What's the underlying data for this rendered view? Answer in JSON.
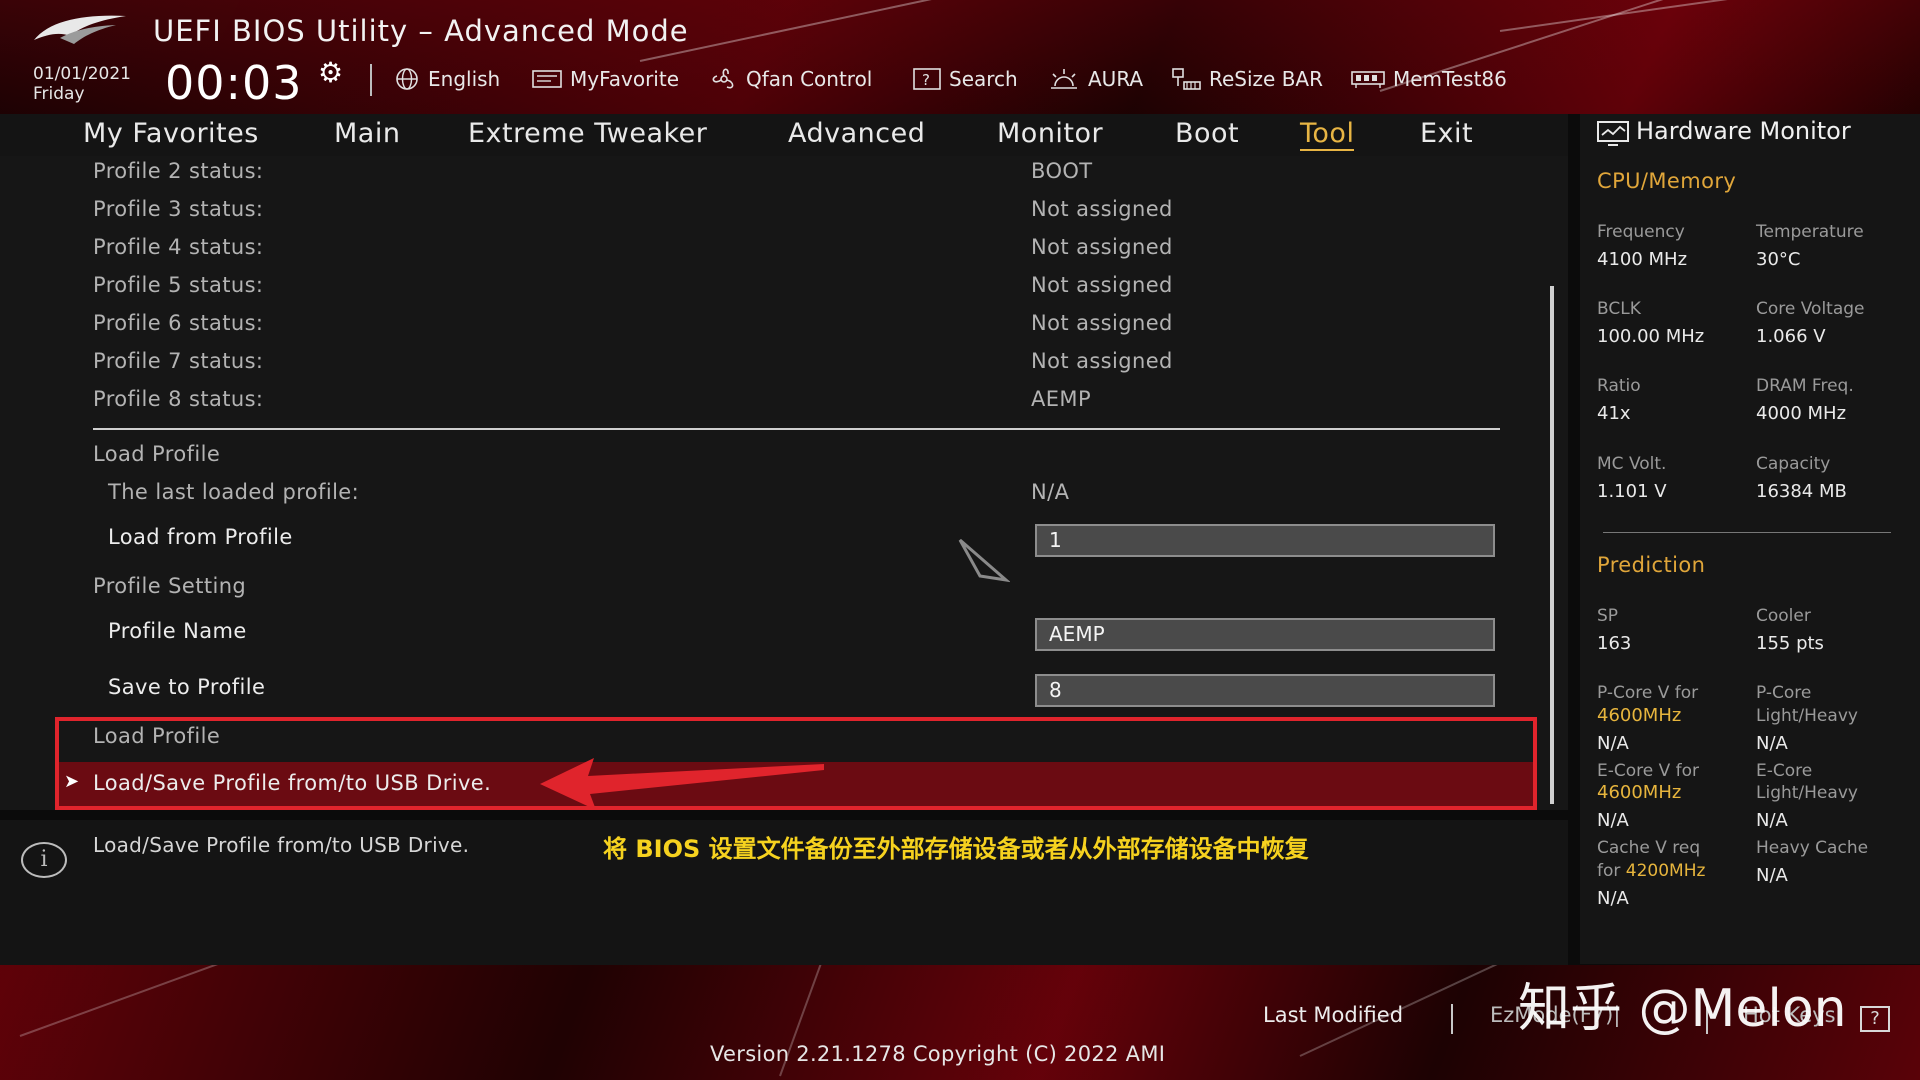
{
  "header": {
    "title": "UEFI BIOS Utility – Advanced Mode",
    "date": "01/01/2021",
    "day": "Friday",
    "time": "00:03",
    "tools": [
      {
        "label": "English",
        "icon": "globe-icon"
      },
      {
        "label": "MyFavorite",
        "icon": "favorite-icon"
      },
      {
        "label": "Qfan Control",
        "icon": "fan-icon"
      },
      {
        "label": "Search",
        "icon": "search-icon"
      },
      {
        "label": "AURA",
        "icon": "aura-icon"
      },
      {
        "label": "ReSize BAR",
        "icon": "resize-bar-icon"
      },
      {
        "label": "MemTest86",
        "icon": "memtest-icon"
      }
    ]
  },
  "nav": {
    "tabs": [
      "My Favorites",
      "Main",
      "Extreme Tweaker",
      "Advanced",
      "Monitor",
      "Boot",
      "Tool",
      "Exit"
    ],
    "active": "Tool"
  },
  "main": {
    "profiles": [
      {
        "label": "Profile 2 status:",
        "value": "BOOT"
      },
      {
        "label": "Profile 3 status:",
        "value": "Not assigned"
      },
      {
        "label": "Profile 4 status:",
        "value": "Not assigned"
      },
      {
        "label": "Profile 5 status:",
        "value": "Not assigned"
      },
      {
        "label": "Profile 6 status:",
        "value": "Not assigned"
      },
      {
        "label": "Profile 7 status:",
        "value": "Not assigned"
      },
      {
        "label": "Profile 8 status:",
        "value": "AEMP"
      }
    ],
    "load_profile_header": "Load Profile",
    "last_loaded_label": "The last loaded profile:",
    "last_loaded_value": "N/A",
    "load_from_label": "Load from Profile",
    "load_from_value": "1",
    "profile_setting_header": "Profile Setting",
    "profile_name_label": "Profile Name",
    "profile_name_value": "AEMP",
    "save_to_label": "Save to Profile",
    "save_to_value": "8",
    "load_profile_header_2": "Load Profile",
    "usb_item": "Load/Save Profile from/to USB Drive."
  },
  "info": {
    "text": "Load/Save Profile from/to USB Drive.",
    "annotation": "将 BIOS 设置文件备份至外部存储设备或者从外部存储设备中恢复"
  },
  "hw_monitor": {
    "title": "Hardware Monitor",
    "cpu_memory": {
      "title": "CPU/Memory",
      "items": [
        {
          "label": "Frequency",
          "value": "4100 MHz"
        },
        {
          "label": "Temperature",
          "value": "30°C"
        },
        {
          "label": "BCLK",
          "value": "100.00 MHz"
        },
        {
          "label": "Core Voltage",
          "value": "1.066 V"
        },
        {
          "label": "Ratio",
          "value": "41x"
        },
        {
          "label": "DRAM Freq.",
          "value": "4000 MHz"
        },
        {
          "label": "MC Volt.",
          "value": "1.101 V"
        },
        {
          "label": "Capacity",
          "value": "16384 MB"
        }
      ]
    },
    "prediction": {
      "title": "Prediction",
      "sp_label": "SP",
      "sp_value": "163",
      "cooler_label": "Cooler",
      "cooler_value": "155 pts",
      "pcore_v_label": "P-Core V for",
      "pcore_v_freq": "4600MHz",
      "pcore_v_value": "N/A",
      "pcore_lh_label_1": "P-Core",
      "pcore_lh_label_2": "Light/Heavy",
      "pcore_lh_value": "N/A",
      "ecore_v_label": "E-Core V for",
      "ecore_v_freq": "4600MHz",
      "ecore_v_value": "N/A",
      "ecore_lh_label_1": "E-Core",
      "ecore_lh_label_2": "Light/Heavy",
      "ecore_lh_value": "N/A",
      "cache_label_1": "Cache V req",
      "cache_label_2": "for",
      "cache_freq": "4200MHz",
      "cache_value": "N/A",
      "heavy_cache_label": "Heavy Cache",
      "heavy_cache_value": "N/A"
    }
  },
  "footer": {
    "last_modified": "Last Modified",
    "ezmode": "EzMode(F7)|",
    "hotkeys": "Hot Keys",
    "hotkeys_key": "?",
    "version": "Version 2.21.1278 Copyright (C) 2022 AMI",
    "watermark": "知乎 @Melon"
  },
  "colors": {
    "accent": "#e8b544",
    "highlight_row": "#6b0b12",
    "annotation_red": "#e0242c",
    "annotation_yellow": "#f6d21f"
  }
}
